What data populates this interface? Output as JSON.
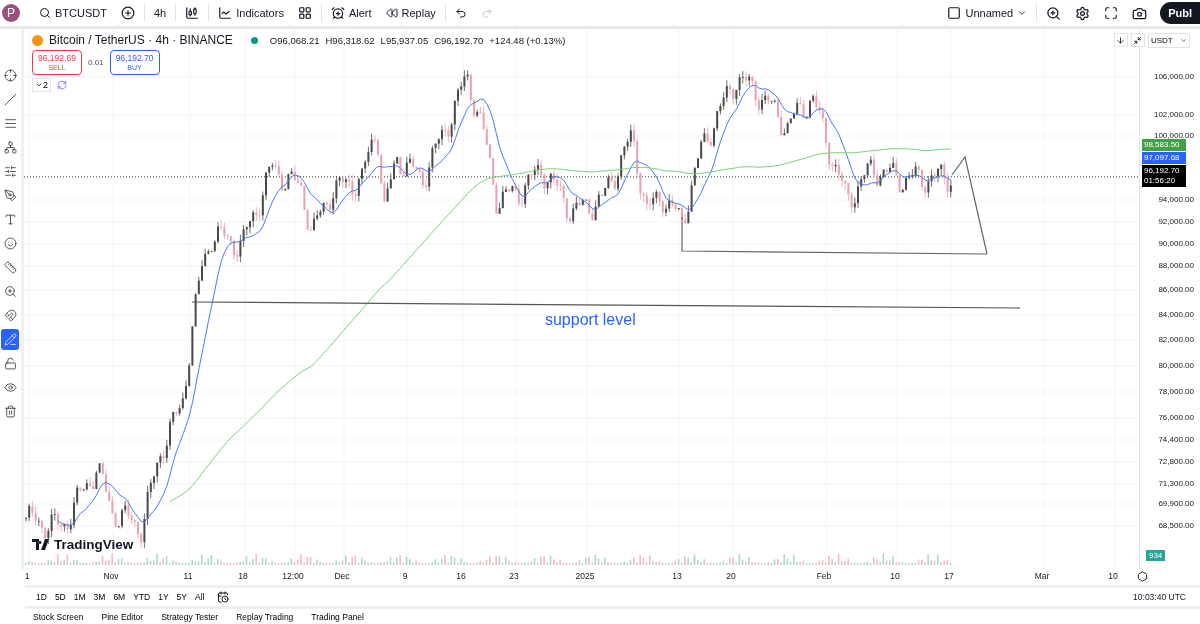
{
  "top_toolbar": {
    "avatar": "P",
    "symbol": "BTCUSDT",
    "interval": "4h",
    "indicators": "Indicators",
    "alert": "Alert",
    "replay": "Replay",
    "layout_name": "Unnamed",
    "publish": "Publ"
  },
  "drawing_tools": [
    {
      "selected": false
    },
    {
      "selected": false
    },
    {
      "selected": false
    },
    {
      "selected": false
    },
    {
      "selected": false
    },
    {
      "selected": false
    },
    {
      "selected": false
    },
    {
      "selected": false
    },
    {
      "selected": false
    },
    {
      "selected": false
    },
    {
      "selected": false
    },
    {
      "selected": true
    },
    {
      "selected": false
    },
    {
      "selected": false
    },
    {
      "selected": false
    }
  ],
  "legend": {
    "title": "Bitcoin / TetherUS · 4h · BINANCE",
    "market_open": true,
    "ohlc": [
      {
        "label": "O",
        "value": "96,068.21"
      },
      {
        "label": "H",
        "value": "96,318.62"
      },
      {
        "label": "L",
        "value": "95,937.05"
      },
      {
        "label": "C",
        "value": "96,192.70"
      }
    ],
    "change": "+124.48 (+0.13%)",
    "sell": {
      "price": "96,192.69",
      "label": "SELL"
    },
    "spread": "0.01",
    "buy": {
      "price": "96,192.70",
      "label": "BUY"
    },
    "indicators_count": "2"
  },
  "chart": {
    "annotation": "support level",
    "logo": "TradingView",
    "volume_badge": "934"
  },
  "price_axis": {
    "currency": "USDT",
    "ticks": [
      "106,000.00",
      "102,000.00",
      "100,000.00",
      "94,000.00",
      "92,000.00",
      "90,000.00",
      "88,000.00",
      "86,000.00",
      "84,000.00",
      "82,000.00",
      "80,000.00",
      "78,000.00",
      "76,000.00",
      "74,400.00",
      "72,800.00",
      "71,300.00",
      "69,900.00",
      "68,500.00"
    ],
    "markers": [
      {
        "value": "98,583.50",
        "color": "#43a047"
      },
      {
        "value": "97,097.68",
        "color": "#2962ff"
      },
      {
        "value": "96,192.70",
        "countdown": "01:56:20",
        "color": "#000000"
      }
    ]
  },
  "time_axis": [
    "1",
    "Nov",
    "11",
    "18",
    "12:00",
    "Dec",
    "9",
    "16",
    "23",
    "2025",
    "13",
    "20",
    "Feb",
    "10",
    "17",
    "Mar",
    "10"
  ],
  "range_bar": {
    "ranges": [
      "1D",
      "5D",
      "1M",
      "3M",
      "6M",
      "YTD",
      "1Y",
      "5Y",
      "All"
    ],
    "clock": "10:03:40 UTC"
  },
  "bottom_tabs": [
    "Stock Screen",
    "Pine Editor",
    "Strategy Tester",
    "Replay Trading",
    "Trading Panel"
  ]
}
